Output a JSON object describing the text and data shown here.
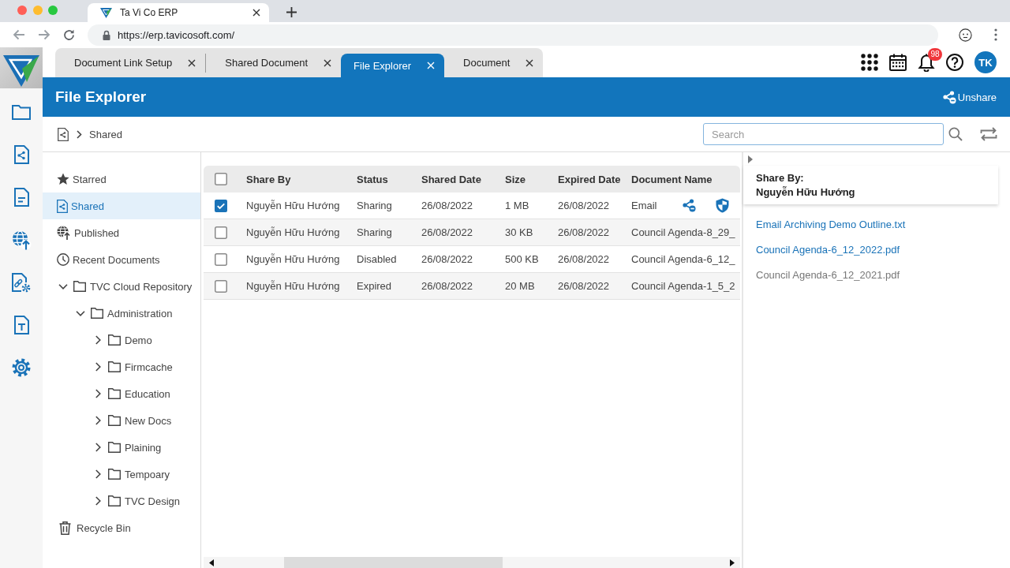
{
  "browser": {
    "tab_title": "Ta Vi Co ERP",
    "url": "https://erp.tavicosoft.com/"
  },
  "app_tabs": [
    {
      "label": "Document Link Setup",
      "selected": false
    },
    {
      "label": "Shared Document",
      "selected": false
    },
    {
      "label": "File Explorer",
      "selected": true
    },
    {
      "label": "Document",
      "selected": false
    }
  ],
  "header": {
    "notification_count": "98",
    "avatar_initials": "TK"
  },
  "page": {
    "title": "File Explorer",
    "action": "Unshare"
  },
  "breadcrumb": {
    "current": "Shared"
  },
  "search": {
    "placeholder": "Search"
  },
  "nav": {
    "items": [
      {
        "label": "Starred",
        "kind": "starred",
        "selected": false
      },
      {
        "label": "Shared",
        "kind": "shared",
        "selected": true
      },
      {
        "label": "Published",
        "kind": "published",
        "selected": false
      },
      {
        "label": "Recent Documents",
        "kind": "recent",
        "selected": false
      },
      {
        "label": "TVC Cloud Repository",
        "kind": "folder",
        "selected": false,
        "expanded": true,
        "children": [
          {
            "label": "Administration",
            "selected": false,
            "expanded": true,
            "children": [
              {
                "label": "Demo",
                "selected": false,
                "expanded": false
              },
              {
                "label": "Firmcache",
                "selected": false,
                "expanded": false
              },
              {
                "label": "Education",
                "selected": false,
                "expanded": false
              },
              {
                "label": "New Docs",
                "selected": false,
                "expanded": false
              },
              {
                "label": "Plaining",
                "selected": false,
                "expanded": false
              },
              {
                "label": "Tempoary",
                "selected": false,
                "expanded": false
              },
              {
                "label": "TVC Design",
                "selected": false,
                "expanded": false
              }
            ]
          }
        ]
      },
      {
        "label": "Recycle Bin",
        "kind": "trash",
        "selected": false
      }
    ]
  },
  "table": {
    "all_checked": false,
    "columns": [
      "Share By",
      "Status",
      "Shared Date",
      "Size",
      "Expired Date",
      "Document Name"
    ],
    "rows": [
      {
        "checked": true,
        "actions_visible": true,
        "cells": [
          "Nguyễn Hữu Hướng",
          "Sharing",
          "26/08/2022",
          "1 MB",
          "26/08/2022",
          "Email"
        ]
      },
      {
        "checked": false,
        "actions_visible": false,
        "cells": [
          "Nguyễn Hữu Hướng",
          "Sharing",
          "26/08/2022",
          "30 KB",
          "26/08/2022",
          "Council Agenda-8_29_"
        ]
      },
      {
        "checked": false,
        "actions_visible": false,
        "cells": [
          "Nguyễn Hữu Hướng",
          "Disabled",
          "26/08/2022",
          "500 KB",
          "26/08/2022",
          "Council Agenda-6_12_"
        ]
      },
      {
        "checked": false,
        "actions_visible": false,
        "cells": [
          "Nguyễn Hữu Hướng",
          "Expired",
          "26/08/2022",
          "20 MB",
          "26/08/2022",
          "Council Agenda-1_5_2"
        ]
      }
    ]
  },
  "details": {
    "label": "Share By:",
    "name": "Nguyễn Hữu Hướng",
    "files": [
      {
        "name": "Email Archiving Demo Outline.txt",
        "disabled": false
      },
      {
        "name": "Council Agenda-6_12_2022.pdf",
        "disabled": false
      },
      {
        "name": "Council Agenda-6_12_2021.pdf",
        "disabled": true
      }
    ]
  }
}
